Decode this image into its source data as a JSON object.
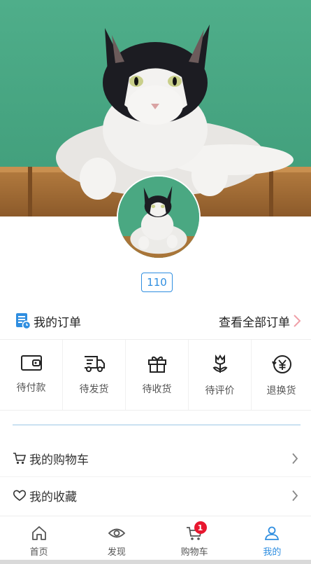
{
  "profile": {
    "banner_image": "cat-photo",
    "avatar_image": "cat-photo",
    "user_id": "110"
  },
  "orders": {
    "title": "我的订单",
    "view_all": "查看全部订单",
    "icon": "order-list-icon",
    "items": [
      {
        "label": "待付款",
        "icon": "wallet-icon"
      },
      {
        "label": "待发货",
        "icon": "delivery-truck-icon"
      },
      {
        "label": "待收货",
        "icon": "gift-box-icon"
      },
      {
        "label": "待评价",
        "icon": "flower-icon"
      },
      {
        "label": "退换货",
        "icon": "refund-yen-icon"
      }
    ]
  },
  "menu": {
    "cart": {
      "label": "我的购物车",
      "icon": "cart-icon"
    },
    "favorites": {
      "label": "我的收藏",
      "icon": "heart-icon"
    }
  },
  "tabbar": {
    "tabs": [
      {
        "label": "首页",
        "icon": "home-icon"
      },
      {
        "label": "发现",
        "icon": "eye-icon"
      },
      {
        "label": "购物车",
        "icon": "cart-icon",
        "badge": "1"
      },
      {
        "label": "我的",
        "icon": "user-icon"
      }
    ],
    "active_index": 3,
    "accent_color": "#2f8ee0",
    "badge_color": "#e8172f"
  }
}
